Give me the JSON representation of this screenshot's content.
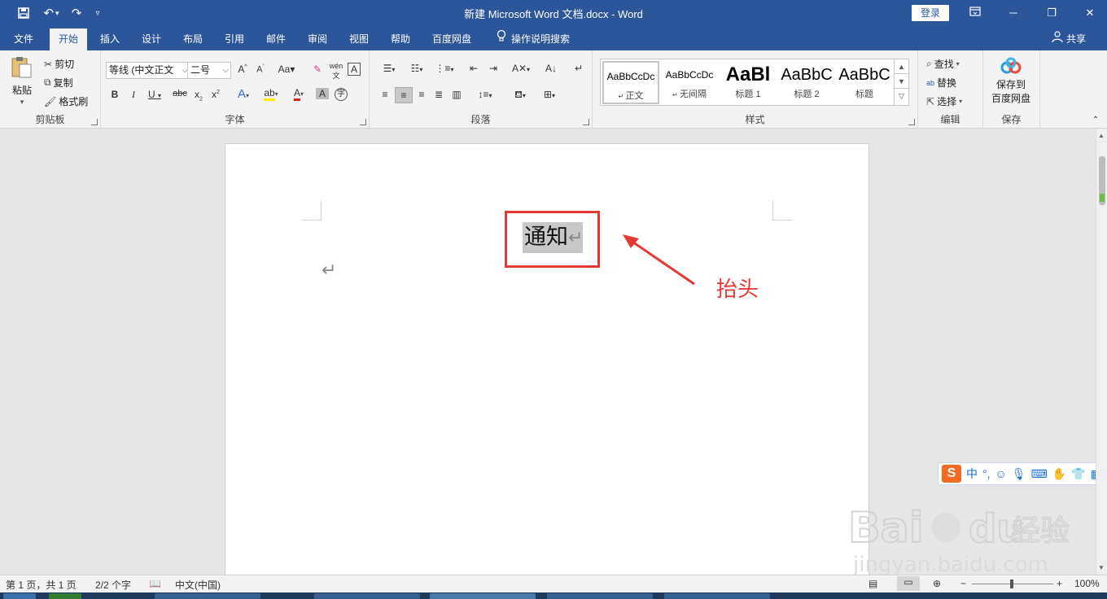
{
  "titlebar": {
    "document_title": "新建 Microsoft Word 文档.docx - Word",
    "login_label": "登录"
  },
  "tabs": [
    "文件",
    "开始",
    "插入",
    "设计",
    "布局",
    "引用",
    "邮件",
    "审阅",
    "视图",
    "帮助",
    "百度网盘"
  ],
  "active_tab": "开始",
  "tell_me": "操作说明搜索",
  "share": "共享",
  "ribbon": {
    "clipboard": {
      "paste": "粘贴",
      "cut": "剪切",
      "copy": "复制",
      "format_painter": "格式刷",
      "label": "剪贴板"
    },
    "font": {
      "font_name": "等线 (中文正文",
      "font_size": "二号",
      "label": "字体"
    },
    "paragraph": {
      "label": "段落"
    },
    "styles": {
      "label": "样式",
      "items": [
        {
          "preview": "AaBbCcDc",
          "name": "正文"
        },
        {
          "preview": "AaBbCcDc",
          "name": "无间隔"
        },
        {
          "preview": "AaBl",
          "name": "标题 1"
        },
        {
          "preview": "AaBbC",
          "name": "标题 2"
        },
        {
          "preview": "AaBbC",
          "name": "标题"
        }
      ]
    },
    "editing": {
      "find": "查找",
      "replace": "替换",
      "select": "选择",
      "label": "编辑"
    },
    "save": {
      "save_to": "保存到",
      "baidu_pan": "百度网盘",
      "label": "保存"
    }
  },
  "document": {
    "title_text": "通知",
    "annotation": "抬头",
    "annotation_color": "#e53935"
  },
  "statusbar": {
    "page": "第 1 页，共 1 页",
    "words": "2/2 个字",
    "language": "中文(中国)",
    "zoom": "100%"
  },
  "ime": {
    "mode": "中"
  },
  "colors": {
    "brand": "#2b579a",
    "ribbon_bg": "#f3f3f3"
  }
}
